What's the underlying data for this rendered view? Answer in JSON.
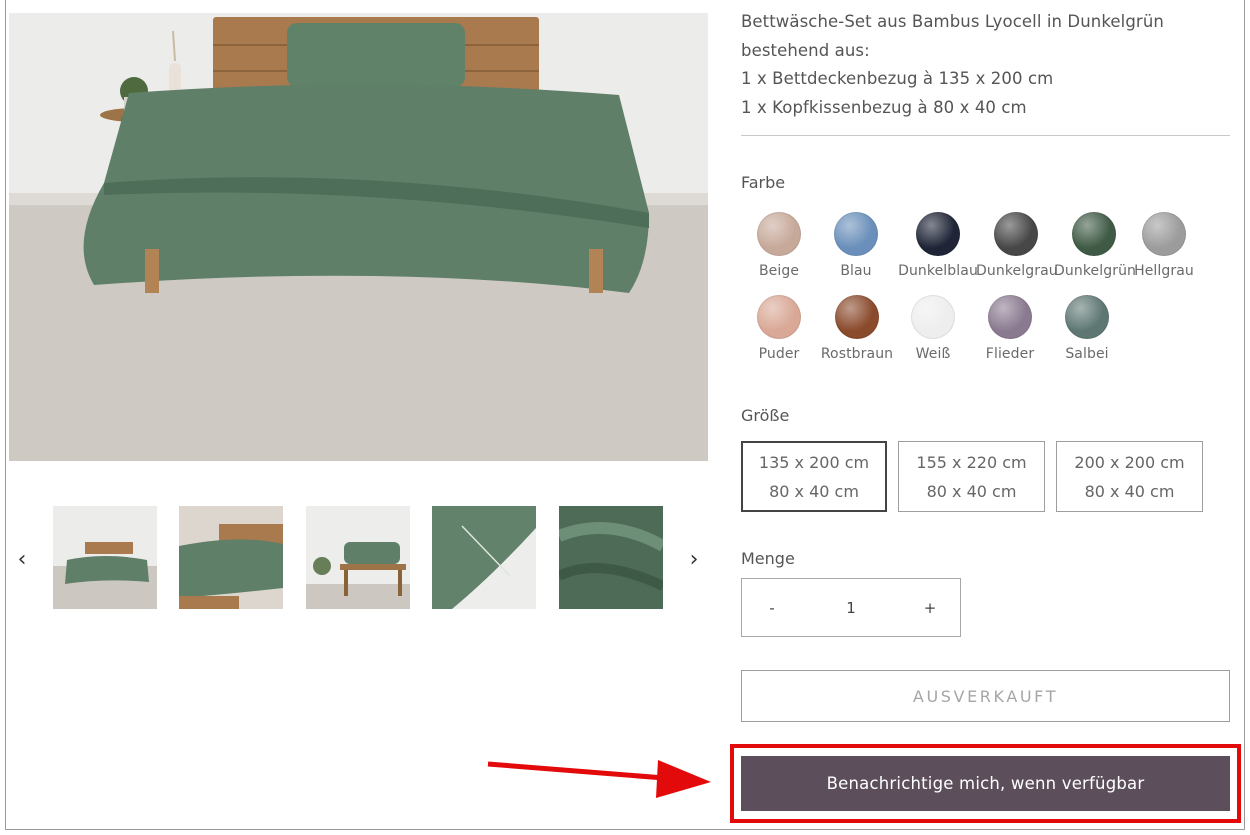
{
  "description_lines": [
    "Bettwäsche-Set aus Bambus Lyocell in Dunkelgrün",
    "bestehend aus:",
    "1 x Bettdeckenbezug à 135 x 200 cm",
    "1 x Kopfkissenbezug à 80 x 40 cm"
  ],
  "color_section": {
    "label": "Farbe",
    "swatches": [
      {
        "name": "Beige",
        "color": "#c7a99a",
        "icon": "swatch-beige-icon"
      },
      {
        "name": "Blau",
        "color": "#6a8fba",
        "icon": "swatch-blau-icon"
      },
      {
        "name": "Dunkelblau",
        "color": "#1f2537",
        "icon": "swatch-dunkelblau-icon"
      },
      {
        "name": "Dunkelgrau",
        "color": "#474747",
        "icon": "swatch-dunkelgrau-icon"
      },
      {
        "name": "Dunkelgrün",
        "color": "#3f5a45",
        "icon": "swatch-dunkelgruen-icon"
      },
      {
        "name": "Hellgrau",
        "color": "#9c9c9c",
        "icon": "swatch-hellgrau-icon"
      },
      {
        "name": "Puder",
        "color": "#d9a896",
        "icon": "swatch-puder-icon"
      },
      {
        "name": "Rostbraun",
        "color": "#8a4a2c",
        "icon": "swatch-rostbraun-icon"
      },
      {
        "name": "Weiß",
        "color": "#eeeeee",
        "icon": "swatch-weiss-icon"
      },
      {
        "name": "Flieder",
        "color": "#8a7a90",
        "icon": "swatch-flieder-icon"
      },
      {
        "name": "Salbei",
        "color": "#5e7773",
        "icon": "swatch-salbei-icon"
      }
    ]
  },
  "size_section": {
    "label": "Größe",
    "options": [
      {
        "line1": "135 x 200 cm",
        "line2": "80 x 40 cm",
        "selected": true
      },
      {
        "line1": "155 x 220 cm",
        "line2": "80 x 40 cm",
        "selected": false
      },
      {
        "line1": "200 x 200 cm",
        "line2": "80 x 40 cm",
        "selected": false
      }
    ]
  },
  "quantity_section": {
    "label": "Menge",
    "minus": "-",
    "value": "1",
    "plus": "+"
  },
  "buttons": {
    "sold_out": "AUSVERKAUFT",
    "notify": "Benachrichtige mich, wenn verfügbar"
  },
  "gallery": {
    "prev_icon": "chevron-left-icon",
    "next_icon": "chevron-right-icon",
    "thumbnails": [
      "bed-full-view",
      "bed-side-view",
      "pillow-on-bench",
      "pillow-zipper-detail",
      "fabric-closeup"
    ]
  },
  "colors": {
    "accent_button": "#5c4f5b",
    "highlight": "#e20a0a",
    "bedding_green": "#5f7f69"
  }
}
